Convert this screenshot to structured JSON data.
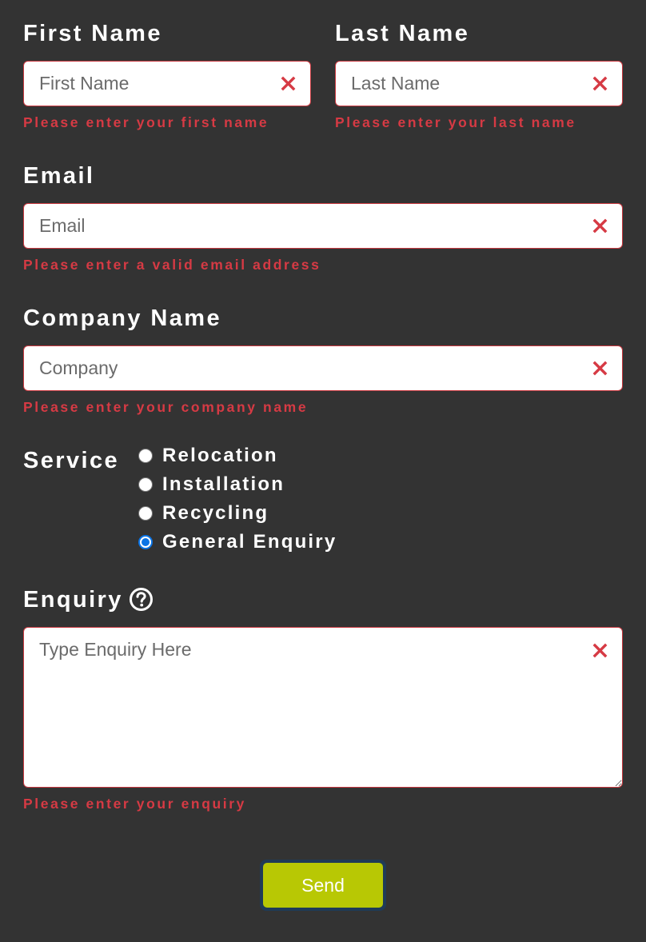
{
  "colors": {
    "background": "#333333",
    "error": "#d63a44",
    "field_border": "#c8383f",
    "send_button": "#b8c804",
    "radio_checked": "#0b74e5"
  },
  "first_name": {
    "label": "First Name",
    "placeholder": "First Name",
    "value": "",
    "error": "Please enter your first name",
    "clear_icon": "close-icon"
  },
  "last_name": {
    "label": "Last Name",
    "placeholder": "Last Name",
    "value": "",
    "error": "Please enter your last name",
    "clear_icon": "close-icon"
  },
  "email": {
    "label": "Email",
    "placeholder": "Email",
    "value": "",
    "error": "Please enter a valid email address",
    "clear_icon": "close-icon"
  },
  "company": {
    "label": "Company Name",
    "placeholder": "Company",
    "value": "",
    "error": "Please enter your company name",
    "clear_icon": "close-icon"
  },
  "service": {
    "label": "Service",
    "options": [
      {
        "label": "Relocation",
        "checked": false
      },
      {
        "label": "Installation",
        "checked": false
      },
      {
        "label": "Recycling",
        "checked": false
      },
      {
        "label": "General Enquiry",
        "checked": true
      }
    ],
    "selected": "General Enquiry"
  },
  "enquiry": {
    "label": "Enquiry",
    "help_icon": "question-circle-icon",
    "placeholder": "Type Enquiry Here",
    "value": "",
    "error": "Please enter your enquiry",
    "clear_icon": "close-icon"
  },
  "submit": {
    "label": "Send"
  }
}
